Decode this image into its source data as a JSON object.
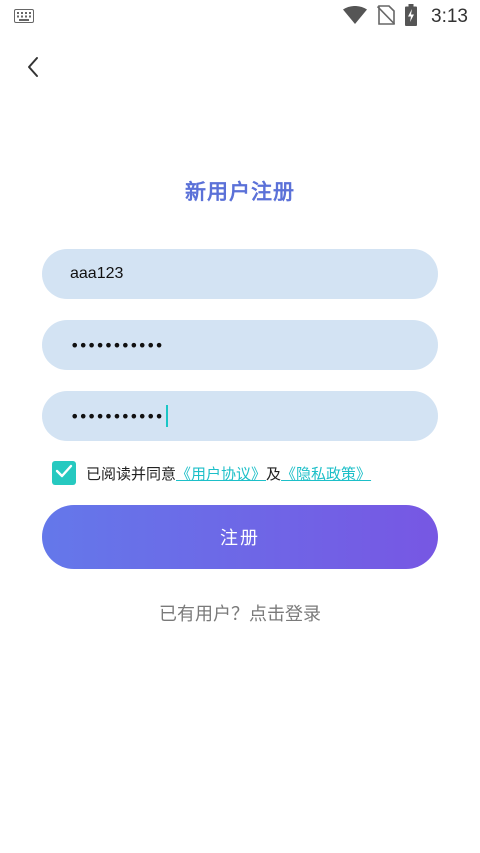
{
  "status_bar": {
    "time": "3:13",
    "icons": [
      "keyboard-icon",
      "wifi-icon",
      "no-sim-icon",
      "battery-charging-icon"
    ]
  },
  "nav": {
    "back_icon": "chevron-left-icon"
  },
  "page": {
    "title": "新用户注册"
  },
  "form": {
    "username_value": "aaa123",
    "password_masked": "•••••••••••",
    "confirm_masked": "•••••••••••",
    "agree_checked": true,
    "agree_prefix": "已阅读并同意",
    "user_agreement": "《用户协议》",
    "agree_and": "及",
    "privacy_policy": "《隐私政策》"
  },
  "actions": {
    "register_label": "注册",
    "login_prompt": "已有用户？点击登录"
  },
  "colors": {
    "title": "#5b71d8",
    "field_bg": "#d3e3f3",
    "checkbox": "#26c9c0",
    "link": "#1dbfc8",
    "button_start": "#6478ea",
    "button_end": "#7757e3",
    "caret": "#19c6c6"
  }
}
